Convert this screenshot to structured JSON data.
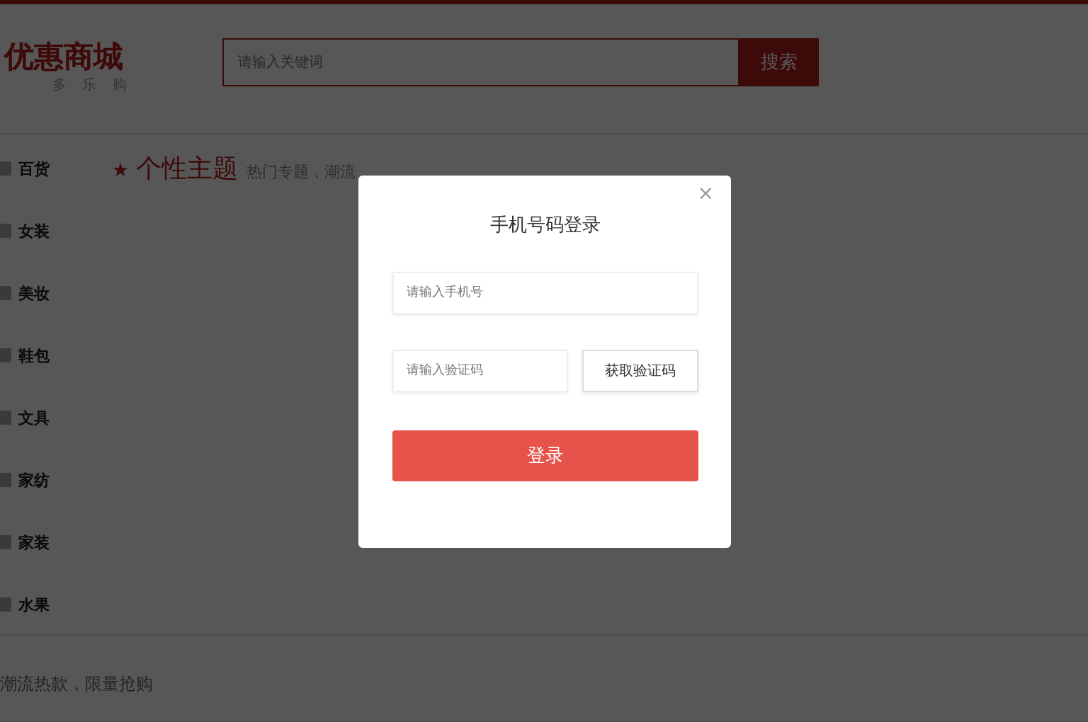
{
  "header": {
    "logo": "优惠商城",
    "slogan": "多 乐 购",
    "search": {
      "placeholder": "请输入关键词"
    },
    "search_button": "搜索"
  },
  "categories": [
    {
      "label": "百货"
    },
    {
      "label": "女装"
    },
    {
      "label": "美妆"
    },
    {
      "label": "鞋包"
    },
    {
      "label": "文具"
    },
    {
      "label": "家纺"
    },
    {
      "label": "家装"
    },
    {
      "label": "水果"
    }
  ],
  "section": {
    "title": "个性主题",
    "subtitle": "热门专题，潮流"
  },
  "footer_text": "潮流热款，限量抢购",
  "login_dialog": {
    "title": "手机号码登录",
    "close": "×",
    "phone": {
      "placeholder": "请输入手机号"
    },
    "code": {
      "placeholder": "请输入验证码"
    },
    "code_button": "获取验证码",
    "submit": "登录"
  }
}
